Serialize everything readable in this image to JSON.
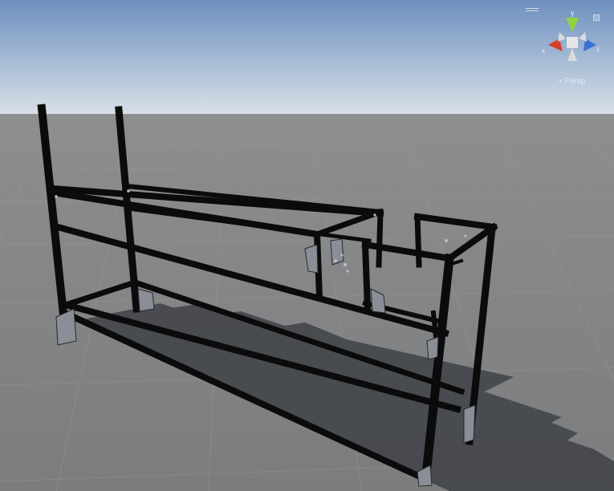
{
  "scene": {
    "sky_top": "#6f8fbf",
    "sky_horizon": "#d7dee6",
    "ground": "#7e7f80",
    "frame_color": "#0d0d0d",
    "shadow_color": "#3a3d44",
    "object": "aluminum-extrusion-frame"
  },
  "gizmo": {
    "axis_y_label": "y",
    "axis_x_label": "x",
    "axis_z_label": "z",
    "projection_label": "Persp",
    "colors": {
      "x": "#d5412a",
      "y": "#8fd33f",
      "z": "#3a72d8",
      "center": "#e6e6e6"
    },
    "menu_icon": "hamburger-icon",
    "lock_icon": "lock-icon"
  }
}
